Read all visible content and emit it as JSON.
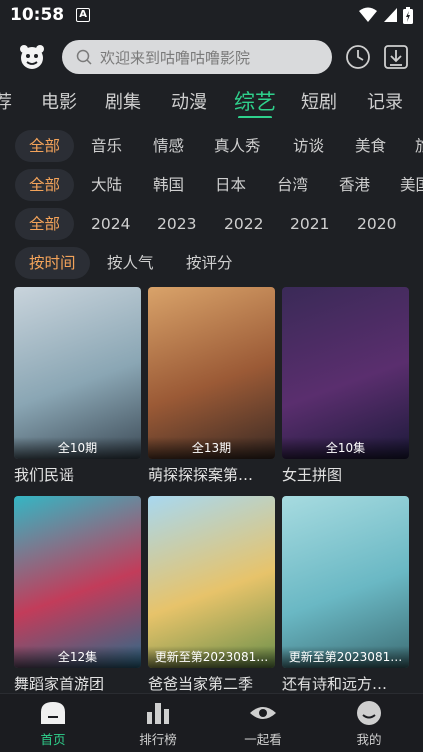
{
  "status": {
    "time": "10:58",
    "notification_letter": "A"
  },
  "search": {
    "placeholder": "欢迎来到咕噜咕噜影院"
  },
  "categories": [
    "荐",
    "电影",
    "剧集",
    "动漫",
    "综艺",
    "短剧",
    "记录"
  ],
  "active_category": "综艺",
  "filters": {
    "type": [
      "全部",
      "音乐",
      "情感",
      "真人秀",
      "访谈",
      "美食",
      "旅"
    ],
    "region": [
      "全部",
      "大陆",
      "韩国",
      "日本",
      "台湾",
      "香港",
      "美国"
    ],
    "year": [
      "全部",
      "2024",
      "2023",
      "2022",
      "2021",
      "2020"
    ],
    "sort": [
      "按时间",
      "按人气",
      "按评分"
    ]
  },
  "cards": [
    {
      "title": "我们民谣",
      "badge": "全10期",
      "colors": [
        "#c9d4dc",
        "#8aa6b4",
        "#3c4a56"
      ]
    },
    {
      "title": "萌探探探案第…",
      "badge": "全13期",
      "colors": [
        "#d9a36a",
        "#9b5a36",
        "#3a2a24"
      ]
    },
    {
      "title": "女王拼图",
      "badge": "全10集",
      "colors": [
        "#3a2a57",
        "#5a2e6e",
        "#1c1a3a"
      ]
    },
    {
      "title": "舞蹈家首游团",
      "badge": "全12集",
      "colors": [
        "#34b6c4",
        "#c23c5a",
        "#2b6b8a"
      ]
    },
    {
      "title": "爸爸当家第二季",
      "badge": "更新至第2023081…",
      "colors": [
        "#a8d8f0",
        "#e7c36a",
        "#6a8f4a"
      ]
    },
    {
      "title": "还有诗和远方…",
      "badge": "更新至第2023081…",
      "colors": [
        "#a7dbe0",
        "#6ab8c4",
        "#3d6d74"
      ]
    }
  ],
  "nav": [
    {
      "label": "首页",
      "icon": "home-icon",
      "active": true
    },
    {
      "label": "排行榜",
      "icon": "bar-chart-icon",
      "active": false
    },
    {
      "label": "一起看",
      "icon": "eye-icon",
      "active": false
    },
    {
      "label": "我的",
      "icon": "face-icon",
      "active": false
    }
  ],
  "accent": "#2fd08c",
  "chip_active_color": "#f3a35a"
}
